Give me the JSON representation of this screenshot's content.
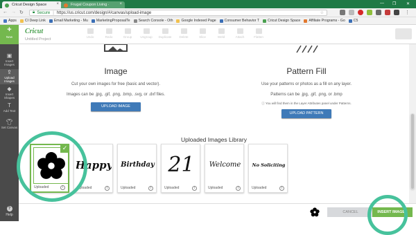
{
  "browser": {
    "tabs": [
      {
        "label": "Cricut Design Space",
        "favicon_color": "#4aa050"
      },
      {
        "label": "Frugal Coupon Living ·",
        "favicon_color": "#e2792f"
      }
    ],
    "window_controls": {
      "minimize": "—",
      "maximize": "❐",
      "close": "✕"
    },
    "security_label": "Secure",
    "url": "https://us.cricut.com/design/#/canvas/upload-image",
    "bookmarks": [
      "Apps",
      "CI Deep Link",
      "Email Marketing - Mu",
      "MarketingProposalTe",
      "Search Console - Oth",
      "Google Indexed Page",
      "Consumer Behavior T",
      "Cricut Design Space",
      "Affiliate Programs - Go",
      "C5"
    ]
  },
  "app": {
    "logo": "Cricut",
    "project_name": "Untitled Project",
    "toolbar": [
      "Undo",
      "Redo",
      "Group",
      "Ungroup",
      "Duplicate",
      "Delete",
      "Slice",
      "Weld",
      "Attach",
      "Flatten"
    ],
    "sidebar": {
      "new_label": "New",
      "items": [
        {
          "label": "Insert Images",
          "icon": "image-icon"
        },
        {
          "label": "Upload Images",
          "icon": "upload-icon"
        },
        {
          "label": "Insert Shapes",
          "icon": "shapes-icon"
        },
        {
          "label": "Add Text",
          "icon": "text-icon"
        },
        {
          "label": "Set Canvas",
          "icon": "shirt-icon"
        }
      ],
      "help_label": "Help"
    }
  },
  "upload": {
    "image": {
      "title": "Image",
      "desc": "Cut your own images for free (basic and vector).",
      "formats": "Images can be .jpg, .gif, .png, .bmp, .svg, or .dxf files.",
      "button": "UPLOAD IMAGE"
    },
    "pattern": {
      "title": "Pattern Fill",
      "desc": "Use your patterns or photos as a fill on any layer.",
      "formats": "Patterns can be .jpg, .gif, .png, or .bmp",
      "note": "You will find them in the Layer Attributes panel under Patterns.",
      "button": "UPLOAD PATTERN"
    }
  },
  "library": {
    "title": "Uploaded Images Library",
    "items": [
      {
        "caption": "Uploaded",
        "text": "",
        "kind": "flower"
      },
      {
        "caption": "Uploaded",
        "text": "Happy",
        "kind": "script"
      },
      {
        "caption": "Uploaded",
        "text": "Birthday",
        "kind": "script"
      },
      {
        "caption": "Uploaded",
        "text": "21",
        "kind": "number"
      },
      {
        "caption": "Uploaded",
        "text": "Welcome",
        "kind": "script"
      },
      {
        "caption": "Uploaded",
        "text": "No Soliciting",
        "kind": "script"
      }
    ]
  },
  "footer": {
    "cancel": "CANCEL",
    "insert": "INSERT IMAGES"
  },
  "colors": {
    "tab_bar": "#1f7a46",
    "sidebar": "#4a4a4a",
    "accent_green": "#74b84e",
    "button_blue": "#3f7ab8",
    "highlight_ring": "#47c29c"
  }
}
